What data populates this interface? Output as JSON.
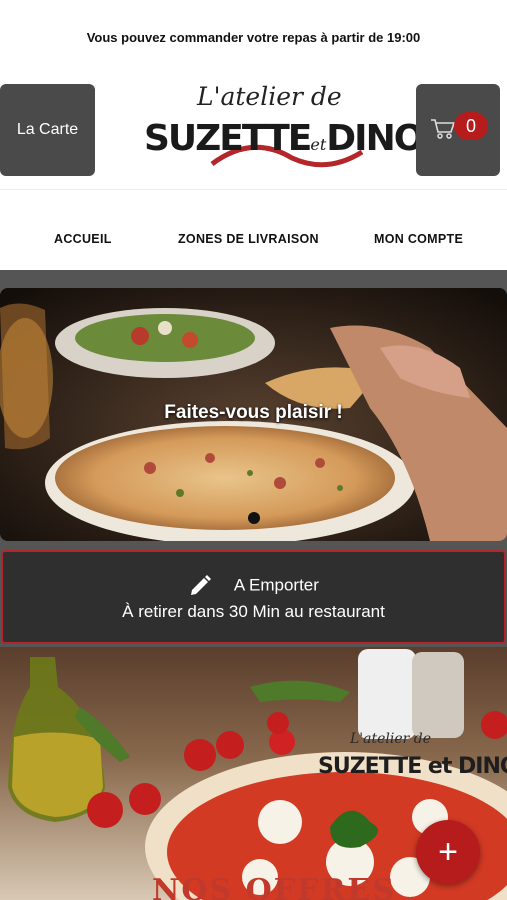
{
  "header": {
    "notice": "Vous pouvez commander votre repas à partir de 19:00",
    "menu_button_label": "La Carte",
    "cart_count": "0",
    "logo": {
      "script_text": "L'atelier de",
      "brand_left": "SUZETTE",
      "brand_mid": "et",
      "brand_right": "DINO"
    }
  },
  "nav": {
    "items": [
      {
        "label": "ACCUEIL"
      },
      {
        "label": "ZONES DE LIVRAISON"
      },
      {
        "label": "MON COMPTE"
      }
    ]
  },
  "hero": {
    "title": "Faites-vous plaisir !"
  },
  "order_mode": {
    "title": "A Emporter",
    "subtitle": "À retirer dans 30 Min au restaurant"
  },
  "offers": {
    "title": "NOS OFFRES",
    "logo_script": "L'atelier de",
    "logo_brand": "SUZETTE et DINO"
  },
  "colors": {
    "accent": "#b71c1c",
    "button_gray": "#4a4a4a",
    "panel_dark": "#2f2f2f"
  },
  "icons": {
    "cart": "cart-icon",
    "pencil": "pencil-icon",
    "fab": "plus-icon"
  }
}
